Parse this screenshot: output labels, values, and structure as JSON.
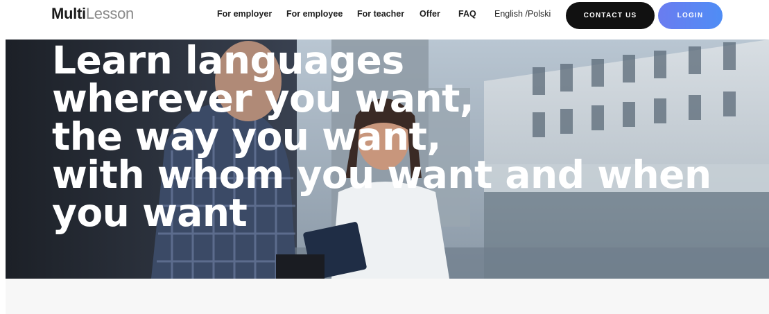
{
  "logo": {
    "bold": "Multi",
    "light": "Lesson"
  },
  "nav": {
    "for_employer": "For employer",
    "for_employee": "For employee",
    "for_teacher": "For teacher",
    "offer": "Offer",
    "faq": "FAQ",
    "language": "English /Polski"
  },
  "buttons": {
    "contact": "CONTACT US",
    "login": "LOGIN"
  },
  "hero": {
    "lines": [
      "Learn languages",
      "wherever you want,",
      "the way you want,",
      "with whom you want and when",
      "you want"
    ]
  },
  "colors": {
    "contact_bg": "#111111",
    "login_gradient_start": "#6a7cf0",
    "login_gradient_end": "#4f8df5",
    "hero_text": "#ffffff"
  }
}
